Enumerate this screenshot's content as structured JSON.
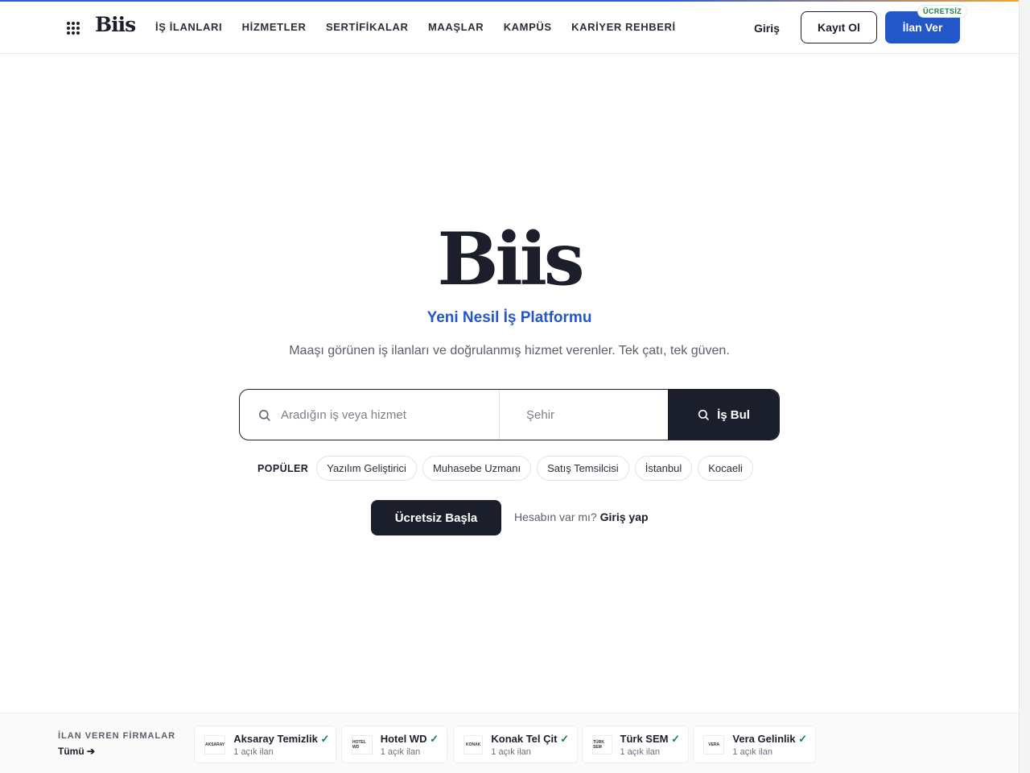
{
  "header": {
    "logo": "Biis",
    "nav": [
      {
        "label": "İŞ İLANLARI"
      },
      {
        "label": "HİZMETLER"
      },
      {
        "label": "SERTİFİKALAR"
      },
      {
        "label": "MAAŞLAR"
      },
      {
        "label": "KAMPÜS"
      },
      {
        "label": "KARİYER REHBERİ"
      }
    ],
    "login_label": "Giriş",
    "register_label": "Kayıt Ol",
    "post_job_label": "İlan Ver",
    "free_badge": "ÜCRETSİZ"
  },
  "hero": {
    "logo": "Biis",
    "tagline": "Yeni Nesil İş Platformu",
    "subtitle": "Maaşı görünen iş ilanları ve doğrulanmış hizmet verenler. Tek çatı, tek güven."
  },
  "search": {
    "query_placeholder": "Aradığın iş veya hizmet",
    "city_placeholder": "Şehir",
    "button_label": "İş Bul"
  },
  "popular": {
    "label": "POPÜLER",
    "items": [
      "Yazılım Geliştirici",
      "Muhasebe Uzmanı",
      "Satış Temsilcisi",
      "İstanbul",
      "Kocaeli"
    ]
  },
  "cta": {
    "start_label": "Ücretsiz Başla",
    "account_question": "Hesabın var mı?",
    "account_login": "Giriş yap"
  },
  "companies": {
    "label": "İLAN VEREN FİRMALAR",
    "all_label": "Tümü",
    "list": [
      {
        "name": "Aksaray Temizlik",
        "count": "1 açık ilan",
        "logo_text": "AKSARAY"
      },
      {
        "name": "Hotel WD",
        "count": "1 açık ilan",
        "logo_text": "HOTEL WD"
      },
      {
        "name": "Konak Tel Çit",
        "count": "1 açık ilan",
        "logo_text": "KONAK"
      },
      {
        "name": "Türk SEM",
        "count": "1 açık ilan",
        "logo_text": "TÜRK SEM"
      },
      {
        "name": "Vera Gelinlik",
        "count": "1 açık ilan",
        "logo_text": "VERA"
      }
    ]
  },
  "colors": {
    "primary": "#2357c9",
    "dark": "#1b1f2b",
    "verified": "#16804a"
  },
  "icons": [
    "apps-grid-icon",
    "search-icon",
    "map-pin-icon",
    "verified-check-icon",
    "arrow-right-icon"
  ]
}
